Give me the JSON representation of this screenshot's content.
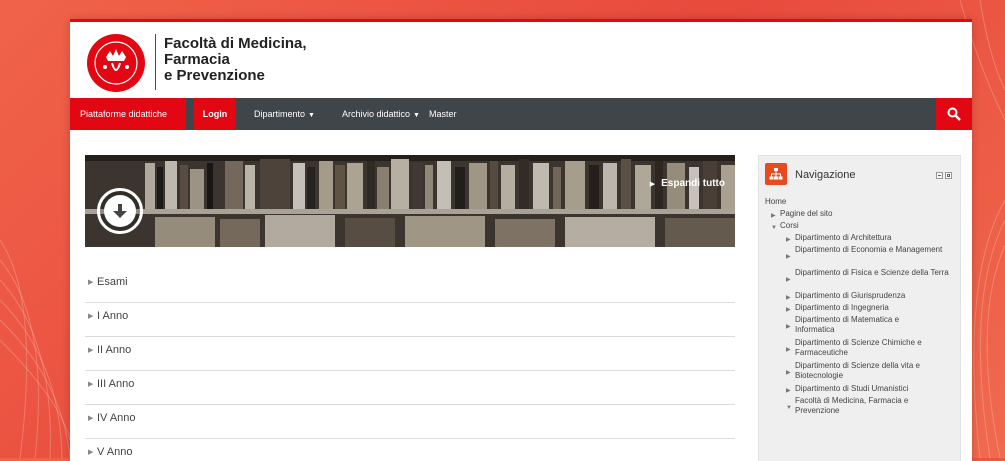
{
  "header": {
    "faculty_name": "Facoltà di Medicina,\nFarmacia\ne Prevenzione"
  },
  "navbar": {
    "items": [
      {
        "label": "Piattaforme didattiche"
      },
      {
        "label": "Login"
      },
      {
        "label": "Dipartimento"
      },
      {
        "label": "Archivio didattico"
      },
      {
        "label": "Master"
      }
    ]
  },
  "course": {
    "expand_all": "Espandi tutto",
    "sections": [
      {
        "label": "Esami"
      },
      {
        "label": "I Anno"
      },
      {
        "label": "II Anno"
      },
      {
        "label": "III Anno"
      },
      {
        "label": "IV Anno"
      },
      {
        "label": "V Anno"
      }
    ]
  },
  "navigation": {
    "title": "Navigazione",
    "home": "Home",
    "site_pages": "Pagine del sito",
    "courses": "Corsi",
    "departments": [
      {
        "label": "Dipartimento di Architettura"
      },
      {
        "label": "Dipartimento di Economia e Management"
      },
      {
        "label": "Dipartimento di Fisica e Scienze della Terra"
      },
      {
        "label": "Dipartimento di Giurisprudenza"
      },
      {
        "label": "Dipartimento di Ingegneria"
      },
      {
        "label": "Dipartimento di Matematica e Informatica"
      },
      {
        "label": "Dipartimento di Scienze Chimiche e Farmaceutiche"
      },
      {
        "label": "Dipartimento di Scienze della vita e Biotecnologie"
      },
      {
        "label": "Dipartimento di Studi Umanistici"
      },
      {
        "label": "Facoltà di Medicina, Farmacia e Prevenzione"
      }
    ]
  },
  "colors": {
    "accent": "#e30613",
    "navbar": "#3f4549",
    "background": "#ef5a44"
  },
  "icons": {
    "search": "search-icon",
    "expand": "arrow-down-circle-icon",
    "navigation": "sitemap-icon"
  }
}
